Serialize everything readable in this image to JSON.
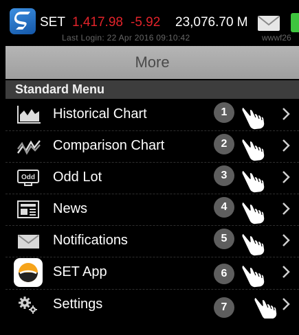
{
  "status_bar": {
    "index_name": "SET",
    "index_value": "1,417.98",
    "index_change": "-5.92",
    "index_volume": "23,076.70 M",
    "last_login": "Last Login: 22 Apr 2016 09:10:42",
    "user_id": "wwwf26"
  },
  "header": {
    "title": "More"
  },
  "section": {
    "title": "Standard Menu"
  },
  "menu": {
    "items": [
      {
        "label": "Historical Chart",
        "badge": "1",
        "icon": "historical-chart-icon"
      },
      {
        "label": "Comparison Chart",
        "badge": "2",
        "icon": "comparison-chart-icon"
      },
      {
        "label": "Odd Lot",
        "badge": "3",
        "icon": "odd-lot-icon",
        "icon_text": "Odd"
      },
      {
        "label": "News",
        "badge": "4",
        "icon": "news-icon"
      },
      {
        "label": "Notifications",
        "badge": "5",
        "icon": "mail-icon"
      },
      {
        "label": "SET App",
        "badge": "6",
        "icon": "set-app-icon"
      },
      {
        "label": "Settings",
        "badge": "7",
        "icon": "gear-icon"
      }
    ]
  },
  "colors": {
    "negative": "#e2232a",
    "battery": "#3ec43e",
    "title_bar": "#a9a9a9",
    "section": "#3d3d3d"
  }
}
